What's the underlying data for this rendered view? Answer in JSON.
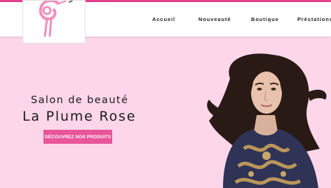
{
  "colors": {
    "accent": "#e63f8f",
    "hero_background": "#fdd6ea",
    "button": "#e8559b",
    "logo_pink": "#f08ec0"
  },
  "logo": {
    "icon": "flamingo-logo-icon"
  },
  "nav": {
    "items": [
      {
        "label": "Accueil"
      },
      {
        "label": "Nouveauté"
      },
      {
        "label": "Boutique"
      },
      {
        "label": "Préstations"
      }
    ]
  },
  "hero": {
    "subtitle": "Salon de beauté",
    "title": "La Plume Rose",
    "cta_label": "DÉCOUVREZ NOS PRODUITS",
    "image": "woman-portrait-photo"
  }
}
